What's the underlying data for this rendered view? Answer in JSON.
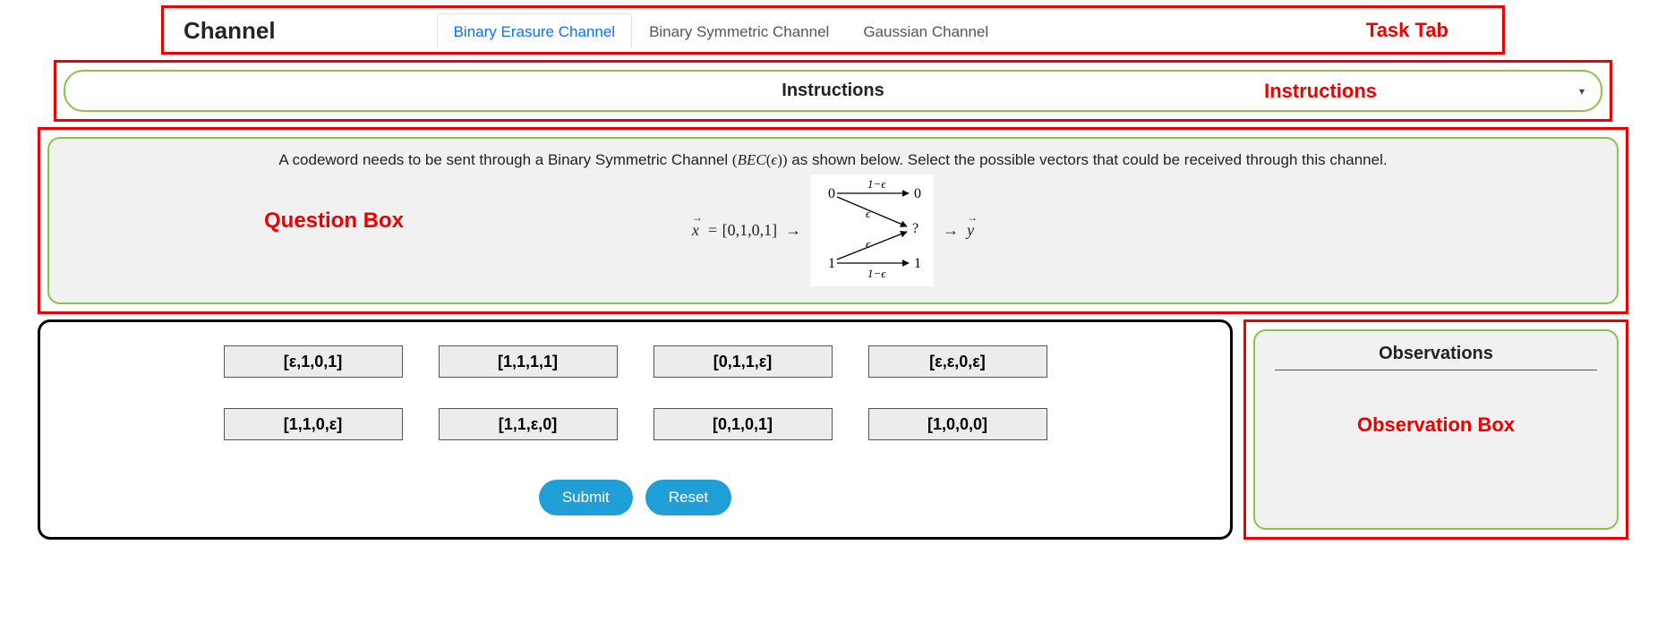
{
  "header": {
    "title": "Channel",
    "tabs": [
      {
        "label": "Binary Erasure Channel",
        "active": true
      },
      {
        "label": "Binary Symmetric Channel",
        "active": false
      },
      {
        "label": "Gaussian Channel",
        "active": false
      }
    ],
    "annotation": "Task Tab"
  },
  "instructions": {
    "label": "Instructions",
    "annotation": "Instructions",
    "chevron": "▾"
  },
  "question": {
    "prompt_pre": "A codeword needs to be sent through a Binary Symmetric Channel ",
    "prompt_math": "(BEC(ϵ))",
    "prompt_post": " as shown below. Select the possible vectors that could be received through this channel.",
    "annotation": "Question Box",
    "diagram": {
      "x_var": "x",
      "x_value": "[0,1,0,1]",
      "arrow": "→",
      "y_var": "y",
      "top_left": "0",
      "top_right": "0",
      "mid_right": "?",
      "bot_left": "1",
      "bot_right": "1",
      "p_keep": "1−ϵ",
      "p_flip": "ϵ"
    }
  },
  "options": [
    "[ε,1,0,1]",
    "[1,1,1,1]",
    "[0,1,1,ε]",
    "[ε,ε,0,ε]",
    "[1,1,0,ε]",
    "[1,1,ε,0]",
    "[0,1,0,1]",
    "[1,0,0,0]"
  ],
  "actions": {
    "submit": "Submit",
    "reset": "Reset"
  },
  "observations": {
    "title": "Observations",
    "annotation": "Observation Box"
  }
}
